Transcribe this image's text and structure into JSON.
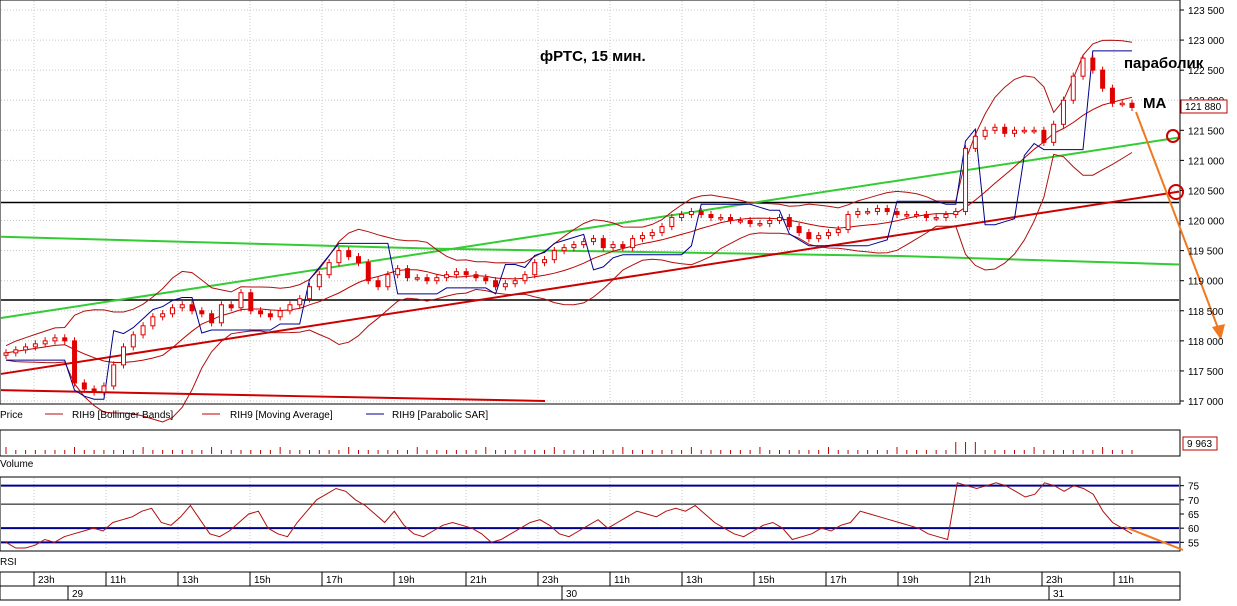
{
  "chart_data": [
    {
      "type": "candlestick",
      "title": "фРТС,  15 мин.",
      "ylim": [
        117000,
        123500
      ],
      "y_ticks": [
        "123 500",
        "123 000",
        "122 500",
        "122 000",
        "121 500",
        "121 000",
        "120 500",
        "120 000",
        "119 500",
        "119 000",
        "118 500",
        "118 000",
        "117 500",
        "117 000"
      ],
      "y_tick_values": [
        123500,
        123000,
        122500,
        122000,
        121500,
        121000,
        120500,
        120000,
        119500,
        119000,
        118500,
        118000,
        117500,
        117000
      ],
      "last_price_label": "121 880",
      "last_price": 121880,
      "annotations": [
        "параболик",
        "MA"
      ],
      "legend": [
        "Price",
        "RIH9 [Bollinger Bands]",
        "RIH9 [Moving Average]",
        "RIH9 [Parabolic SAR]"
      ],
      "horizontal_levels": [
        120300,
        118680
      ],
      "colors": {
        "candle": "#e00000",
        "bollinger": "#b01010",
        "ma": "#c00000",
        "sar": "#000090",
        "trend_green": "#33cc33",
        "trend_red": "#cc0000",
        "arrow": "#f07820",
        "level": "#000000"
      },
      "close_series": [
        117800,
        117850,
        117900,
        117950,
        118000,
        118050,
        118000,
        117300,
        117200,
        117150,
        117250,
        117600,
        117900,
        118100,
        118250,
        118400,
        118450,
        118550,
        118600,
        118500,
        118450,
        118300,
        118600,
        118550,
        118800,
        118500,
        118450,
        118400,
        118500,
        118600,
        118700,
        118900,
        119100,
        119300,
        119500,
        119400,
        119300,
        119000,
        118900,
        119100,
        119200,
        119050,
        119050,
        119000,
        119050,
        119100,
        119150,
        119100,
        119050,
        119000,
        118900,
        118950,
        119000,
        119100,
        119300,
        119350,
        119500,
        119550,
        119600,
        119650,
        119700,
        119550,
        119600,
        119550,
        119700,
        119750,
        119800,
        119900,
        120050,
        120100,
        120150,
        120100,
        120050,
        120050,
        120000,
        120000,
        119950,
        119950,
        120000,
        120050,
        119900,
        119800,
        119700,
        119750,
        119800,
        119850,
        120100,
        120150,
        120150,
        120200,
        120150,
        120100,
        120100,
        120100,
        120050,
        120050,
        120100,
        120150,
        121200,
        121400,
        121500,
        121550,
        121450,
        121500,
        121500,
        121500,
        121300,
        121600,
        122000,
        122400,
        122700,
        122500,
        122200,
        121950,
        121950,
        121880
      ]
    },
    {
      "type": "bar",
      "title": "Volume",
      "last_value_label": "9 963"
    },
    {
      "type": "line",
      "title": "RSI",
      "y_ticks": [
        "75",
        "70",
        "65",
        "60",
        "55"
      ],
      "y_tick_values": [
        75,
        70,
        65,
        60,
        55
      ],
      "ylim": [
        53,
        77
      ],
      "levels": [
        75,
        68.5,
        60,
        55
      ],
      "values": [
        55,
        53,
        52,
        54,
        56,
        55,
        57,
        58,
        59,
        60,
        59,
        62,
        63,
        64,
        66,
        67,
        62,
        61,
        64,
        68,
        63,
        58,
        57,
        59,
        62,
        65,
        66,
        60,
        58,
        57,
        62,
        66,
        70,
        72,
        74,
        73,
        70,
        68,
        65,
        62,
        66,
        61,
        58,
        57,
        59,
        61,
        62,
        61,
        60,
        58,
        55,
        56,
        58,
        60,
        62,
        63,
        61,
        58,
        57,
        59,
        61,
        63,
        60,
        62,
        64,
        66,
        65,
        64,
        66,
        67,
        66,
        68,
        65,
        62,
        60,
        58,
        57,
        59,
        61,
        62,
        60,
        56,
        57,
        58,
        60,
        59,
        61,
        62,
        66,
        65,
        64,
        63,
        62,
        61,
        60,
        58,
        57,
        56,
        76,
        75,
        74,
        75,
        76,
        75,
        73,
        71,
        72,
        76,
        75,
        73,
        75,
        74,
        72,
        66,
        62,
        60,
        58
      ]
    }
  ],
  "time_axis": {
    "hour_labels": [
      "23h",
      "11h",
      "13h",
      "15h",
      "17h",
      "19h",
      "21h",
      "23h",
      "11h",
      "13h",
      "15h",
      "17h",
      "19h",
      "21h",
      "23h",
      "11h"
    ],
    "day_labels": [
      "29",
      "30",
      "31"
    ]
  },
  "labels": {
    "volume_label": "Volume",
    "rsi_label": "RSI"
  }
}
